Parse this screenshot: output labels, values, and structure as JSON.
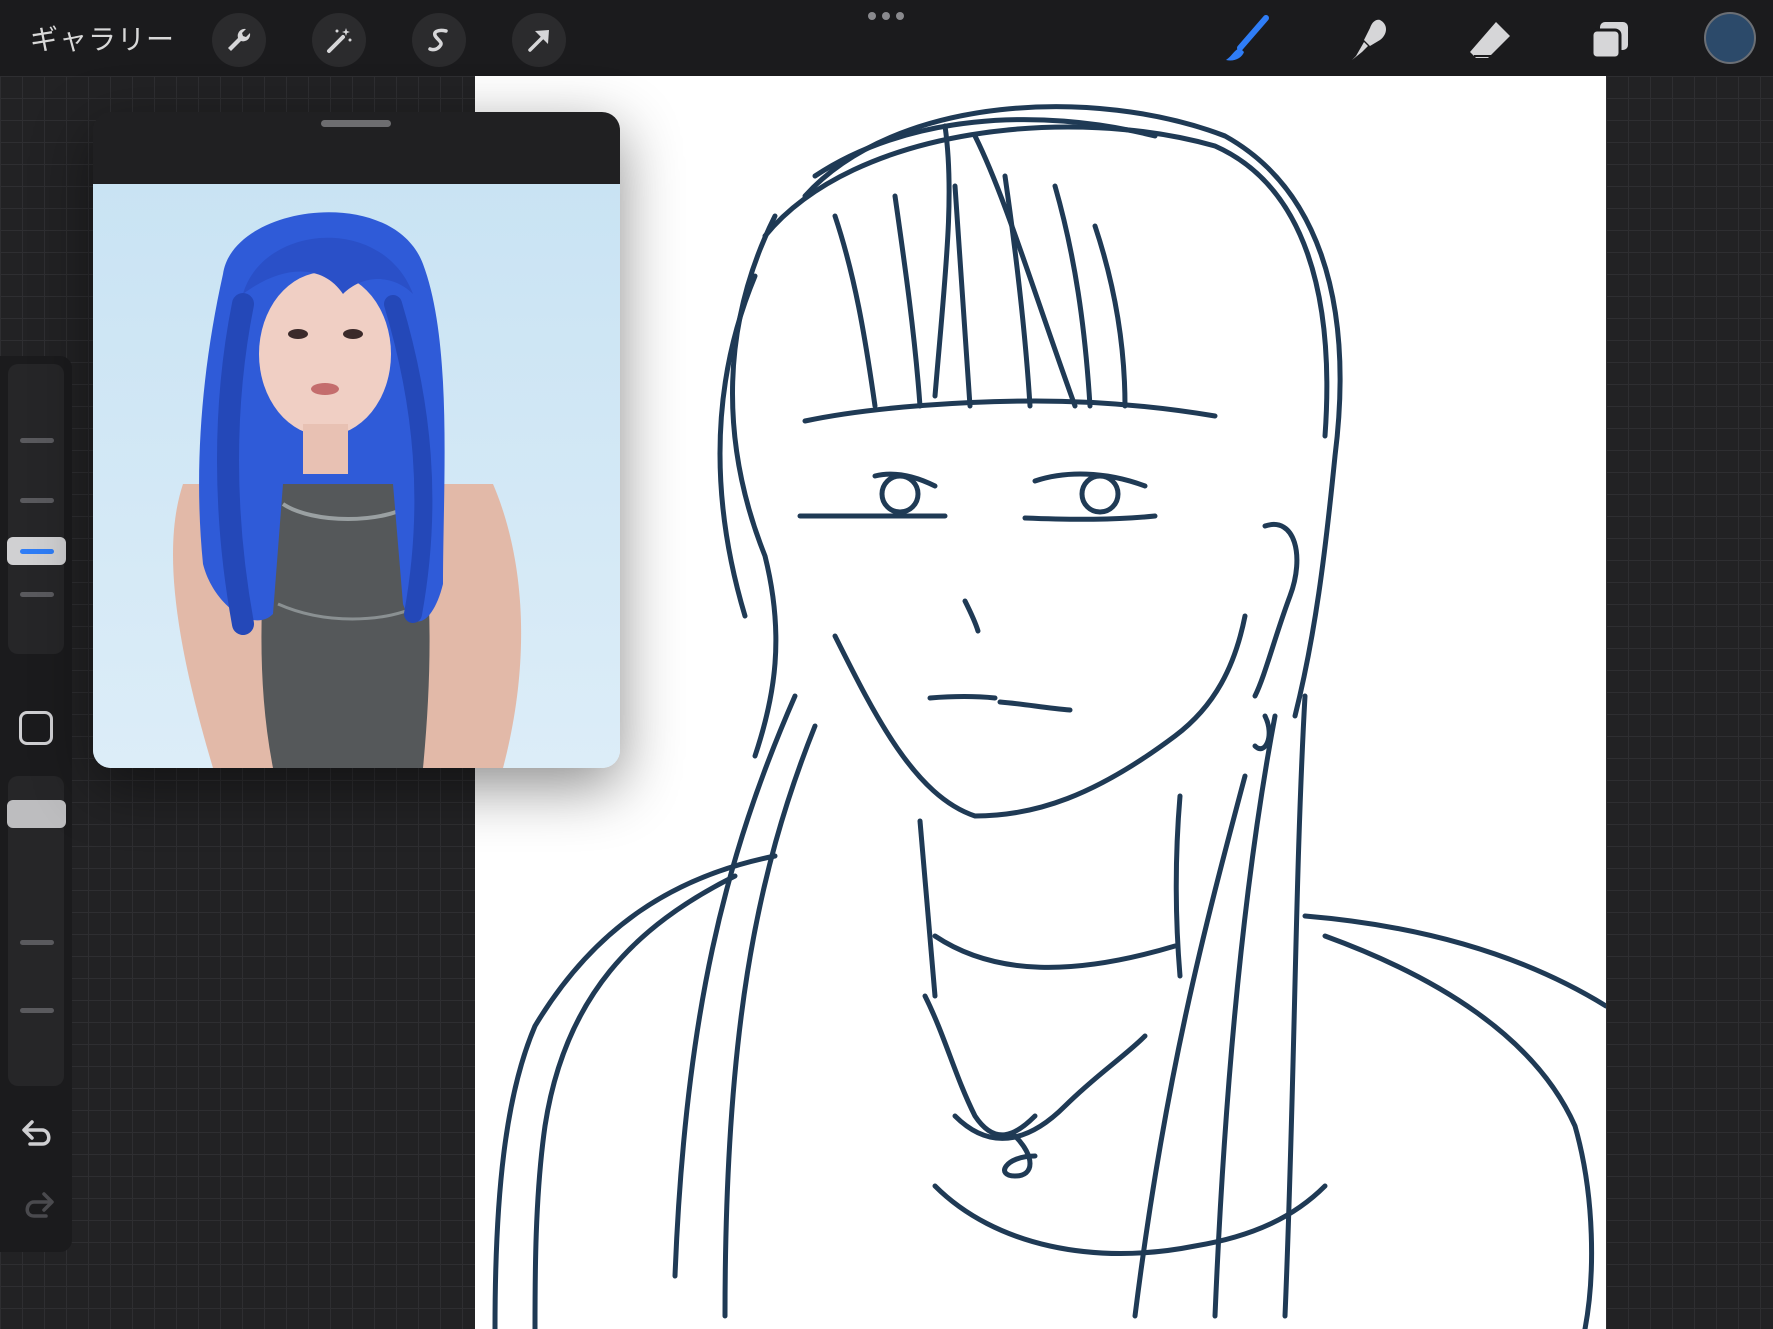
{
  "topbar": {
    "gallery_label": "ギャラリー",
    "left_tools": [
      "wrench-icon",
      "magic-wand-icon",
      "selection-icon",
      "transform-arrow-icon"
    ],
    "right_tools": [
      "brush-icon",
      "smudge-icon",
      "eraser-icon",
      "layers-icon"
    ],
    "active_tool": "brush-icon",
    "accent_color": "#2f7df6",
    "current_color": "#2c4a6a"
  },
  "sidebar": {
    "brush_size_level": 0.4,
    "buttons": [
      "modify-square-icon",
      "undo-icon",
      "redo-icon"
    ]
  },
  "reference": {
    "image": "blue-haired-woman-photo",
    "background_color": "#d8ebf6",
    "hair_color": "#2f5bd8"
  },
  "canvas": {
    "stroke_color": "#1f3a55",
    "background": "#ffffff"
  }
}
